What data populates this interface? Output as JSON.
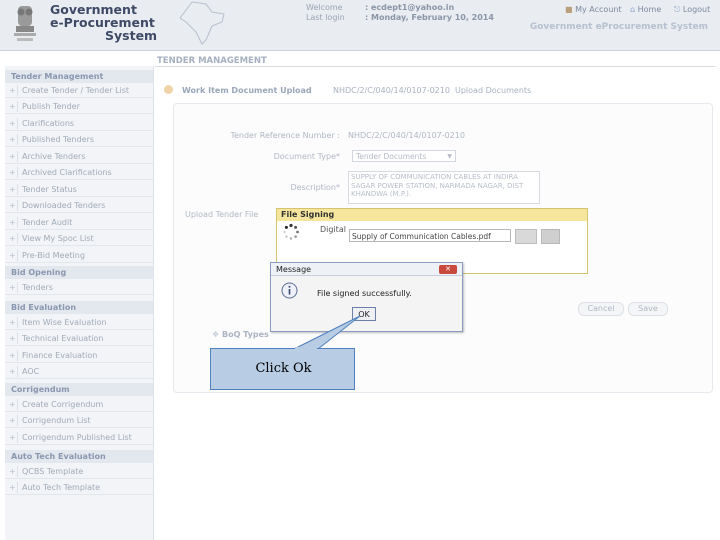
{
  "header": {
    "logo_line1": "Government",
    "logo_line2": "e-Procurement",
    "logo_line3": "System",
    "welcome_label": "Welcome",
    "welcome_value": ": ecdept1@yahoo.in",
    "lastlogin_label": "Last login",
    "lastlogin_value": ": Monday, February 10, 2014",
    "my_account": "My Account",
    "home": "Home",
    "logout": "Logout",
    "system_title": "Government eProcurement System"
  },
  "section_title": "TENDER MANAGEMENT",
  "sidebar": {
    "groups": [
      {
        "title": "Tender Management",
        "items": [
          "Create Tender / Tender List",
          "Publish Tender",
          "Clarifications",
          "Published Tenders",
          "Archive Tenders",
          "Archived Clarifications",
          "Tender Status",
          "Downloaded Tenders",
          "Tender Audit",
          "View My Spoc List",
          "Pre-Bid Meeting"
        ]
      },
      {
        "title": "Bid Opening",
        "items": [
          "Tenders"
        ]
      },
      {
        "title": "Bid Evaluation",
        "items": [
          "Item Wise Evaluation",
          "Technical Evaluation",
          "Finance Evaluation",
          "AOC"
        ]
      },
      {
        "title": "Corrigendum",
        "items": [
          "Create Corrigendum",
          "Corrigendum List",
          "Corrigendum Published List"
        ]
      },
      {
        "title": "Auto Tech Evaluation",
        "items": [
          "QCBS Template",
          "Auto Tech Template"
        ]
      }
    ]
  },
  "breadcrumb": {
    "page": "Work Item Document Upload",
    "tender": "NHDC/2/C/040/14/0107-0210",
    "current": "Upload Documents"
  },
  "form": {
    "tender_ref_label": "Tender Reference Number :",
    "tender_ref_value": "NHDC/2/C/040/14/0107-0210",
    "doc_type_label": "Document Type*",
    "doc_type_value": "Tender Documents",
    "description_label": "Description*",
    "description_value": "SUPPLY OF COMMUNICATION CABLES AT INDIRA SAGAR POWER STATION, NARMADA NAGAR, DIST KHANDWA (M.P.).",
    "upload_label": "Upload Tender File",
    "cancel": "Cancel",
    "save": "Save",
    "boq": "BoQ Types"
  },
  "file_signing": {
    "title": "File Signing",
    "digital_label": "Digital",
    "file_value": "Supply of Communication Cables.pdf"
  },
  "message": {
    "title": "Message",
    "text": "File signed successfully.",
    "ok": "OK"
  },
  "callout": "Click Ok",
  "colors": {
    "callout_fill": "#b8cce4",
    "callout_border": "#4f81bd",
    "signing_title": "#f6e59d"
  }
}
